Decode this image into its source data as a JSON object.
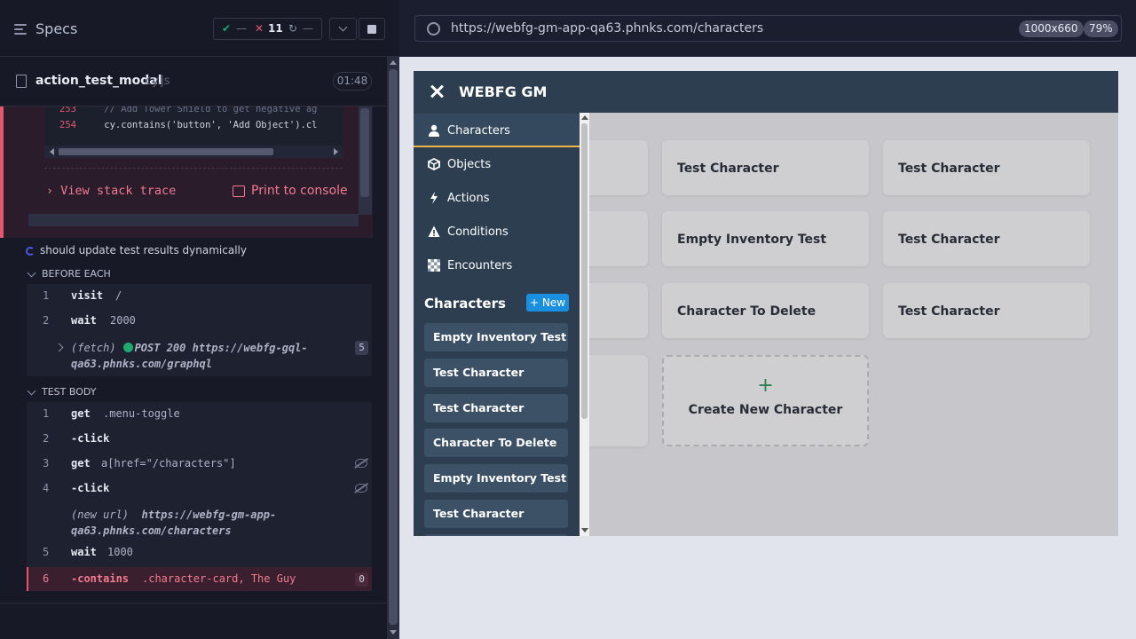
{
  "runner": {
    "specs_label": "Specs",
    "passed": "—",
    "failed": "11",
    "pending": "—",
    "file_name": "action_test_modal",
    "file_ext": "cy.js",
    "timer": "01:48",
    "code_lines": [
      {
        "num": "253",
        "text": "    // Add Tower Shield to get negative ag"
      },
      {
        "num": "254",
        "text": "    cy.contains('button', 'Add Object').cl"
      }
    ],
    "view_stack": "View stack trace",
    "print_console": "Print to console",
    "test_title": "should update test results dynamically",
    "before_each": "BEFORE EACH",
    "test_body": "TEST BODY",
    "before_cmds": [
      {
        "n": "1",
        "k": "visit",
        "a": "/"
      },
      {
        "n": "2",
        "k": "wait",
        "a": "2000"
      }
    ],
    "fetch_label": "(fetch)",
    "fetch_text": "POST 200 https://webfg-gql-qa63.phnks.com/graphql",
    "fetch_count": "5",
    "body_cmds": [
      {
        "n": "1",
        "k": "get",
        "a": ".menu-toggle"
      },
      {
        "n": "2",
        "k": "-click",
        "a": ""
      },
      {
        "n": "3",
        "k": "get",
        "a": "a[href=\"/characters\"]"
      },
      {
        "n": "4",
        "k": "-click",
        "a": ""
      },
      {
        "n": "5",
        "k": "wait",
        "a": "1000"
      },
      {
        "n": "6",
        "k": "-contains",
        "a": ".character-card, The Guy"
      }
    ],
    "new_url_label": "(new url)",
    "new_url": "https://webfg-gm-app-qa63.phnks.com/characters",
    "fail_count": "0"
  },
  "browser": {
    "url": "https://webfg-gm-app-qa63.phnks.com/characters",
    "viewport": "1000x660",
    "zoom": "79%"
  },
  "app": {
    "title": "WEBFG GM",
    "nav": [
      {
        "label": "Characters",
        "icon": "user-icon"
      },
      {
        "label": "Objects",
        "icon": "cube-icon"
      },
      {
        "label": "Actions",
        "icon": "bolt-icon"
      },
      {
        "label": "Conditions",
        "icon": "warning-icon"
      },
      {
        "label": "Encounters",
        "icon": "checker-icon"
      }
    ],
    "sidebar_heading": "Characters",
    "new_button": "+ New",
    "sidebar_chars": [
      "Empty Inventory Test",
      "Test Character",
      "Test Character",
      "Character To Delete",
      "Empty Inventory Test",
      "Test Character"
    ],
    "cards": [
      "Test Character",
      "Test Character",
      "Empty Inventory Test",
      "Test Character",
      "Character To Delete",
      "Test Character"
    ],
    "create_plus": "+",
    "create_label": "Create New Character"
  },
  "colors": {
    "fail": "#e45770",
    "pass": "#1fa971",
    "accent": "#f0b64b",
    "primary": "#1a8fe0",
    "header": "#2c3e50"
  }
}
